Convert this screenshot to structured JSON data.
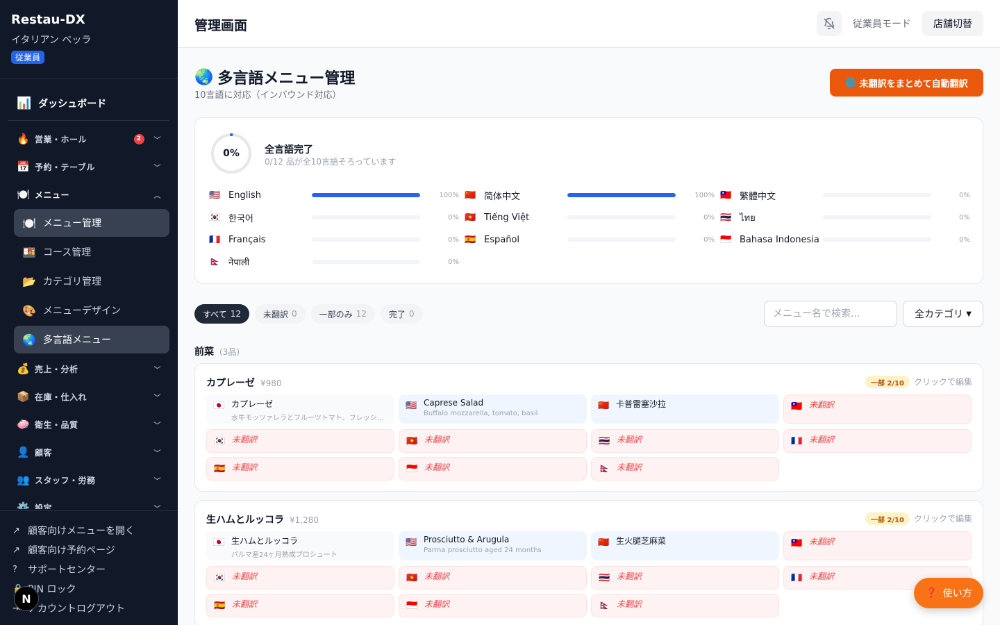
{
  "sidebar": {
    "brand": "Restau-DX",
    "store": "イタリアン ベッラ",
    "role": "従業員",
    "dashboard": "ダッシュボード",
    "groups": [
      {
        "label": "営業・ホール",
        "icon": "🔥",
        "count": "2"
      },
      {
        "label": "予約・テーブル",
        "icon": "📅"
      },
      {
        "label": "メニュー",
        "icon": "🍽️"
      },
      {
        "label": "売上・分析",
        "icon": "💰"
      },
      {
        "label": "在庫・仕入れ",
        "icon": "📦"
      },
      {
        "label": "衛生・品質",
        "icon": "🧼"
      },
      {
        "label": "顧客",
        "icon": "👤"
      },
      {
        "label": "スタッフ・労務",
        "icon": "👥"
      },
      {
        "label": "設定",
        "icon": "⚙️"
      }
    ],
    "menu_items": [
      {
        "label": "メニュー管理",
        "icon": "🍽️"
      },
      {
        "label": "コース管理",
        "icon": "🍱"
      },
      {
        "label": "カテゴリ管理",
        "icon": "📂"
      },
      {
        "label": "メニューデザイン",
        "icon": "🎨"
      },
      {
        "label": "多言語メニュー",
        "icon": "🌏"
      }
    ],
    "bottom_links": [
      "顧客向けメニューを開く",
      "顧客向け予約ページ",
      "サポートセンター",
      "PIN ロック",
      "アカウントログアウト"
    ]
  },
  "header": {
    "title": "管理画面",
    "staff_mode": "従業員モード",
    "store_switch": "店舗切替"
  },
  "main": {
    "heading": "多言語メニュー管理",
    "subheading": "10言語に対応（インバウンド対応）",
    "auto_translate": "未翻訳をまとめて自動翻訳"
  },
  "progress": {
    "overall_pct": "0%",
    "overall": 0,
    "title": "全言語完了",
    "subtitle": "0/12 品が全10言語そろっています",
    "languages": [
      {
        "flag": "🇺🇸",
        "name": "English",
        "pct": "100%",
        "value": 100
      },
      {
        "flag": "🇨🇳",
        "name": "简体中文",
        "pct": "100%",
        "value": 100
      },
      {
        "flag": "🇹🇼",
        "name": "繁體中文",
        "pct": "0%",
        "value": 0
      },
      {
        "flag": "🇰🇷",
        "name": "한국어",
        "pct": "0%",
        "value": 0
      },
      {
        "flag": "🇻🇳",
        "name": "Tiếng Việt",
        "pct": "0%",
        "value": 0
      },
      {
        "flag": "🇹🇭",
        "name": "ไทย",
        "pct": "0%",
        "value": 0
      },
      {
        "flag": "🇫🇷",
        "name": "Français",
        "pct": "0%",
        "value": 0
      },
      {
        "flag": "🇪🇸",
        "name": "Español",
        "pct": "0%",
        "value": 0
      },
      {
        "flag": "🇮🇩",
        "name": "Bahasa Indonesia",
        "pct": "0%",
        "value": 0
      },
      {
        "flag": "🇳🇵",
        "name": "नेपाली",
        "pct": "0%",
        "value": 0
      }
    ]
  },
  "filters": {
    "chips": [
      {
        "label": "すべて",
        "count": "12"
      },
      {
        "label": "未翻訳",
        "count": "0"
      },
      {
        "label": "一部のみ",
        "count": "12"
      },
      {
        "label": "完了",
        "count": "0"
      }
    ],
    "search_placeholder": "メニュー名で検索...",
    "category": "全カテゴリ"
  },
  "section": {
    "name": "前菜",
    "count": "(3品)"
  },
  "items": [
    {
      "name": "カプレーゼ",
      "price": "¥980",
      "badge": "一部 2/10",
      "edit_hint": "クリックで編集",
      "cells": [
        {
          "flag": "🇯🇵",
          "text": "カプレーゼ",
          "desc": "水牛モッツァレラとフルーツトマト、フレッシュバジル",
          "state": "src"
        },
        {
          "flag": "🇺🇸",
          "text": "Caprese Salad",
          "desc": "Buffalo mozzarella, tomato, basil",
          "state": "done"
        },
        {
          "flag": "🇨🇳",
          "text": "卡普雷塞沙拉",
          "desc": "",
          "state": "done"
        },
        {
          "flag": "🇹🇼",
          "text": "未翻訳",
          "state": "miss"
        },
        {
          "flag": "🇰🇷",
          "text": "未翻訳",
          "state": "miss"
        },
        {
          "flag": "🇻🇳",
          "text": "未翻訳",
          "state": "miss"
        },
        {
          "flag": "🇹🇭",
          "text": "未翻訳",
          "state": "miss"
        },
        {
          "flag": "🇫🇷",
          "text": "未翻訳",
          "state": "miss"
        },
        {
          "flag": "🇪🇸",
          "text": "未翻訳",
          "state": "miss"
        },
        {
          "flag": "🇮🇩",
          "text": "未翻訳",
          "state": "miss"
        },
        {
          "flag": "🇳🇵",
          "text": "未翻訳",
          "state": "miss"
        }
      ]
    },
    {
      "name": "生ハムとルッコラ",
      "price": "¥1,280",
      "badge": "一部 2/10",
      "edit_hint": "クリックで編集",
      "cells": [
        {
          "flag": "🇯🇵",
          "text": "生ハムとルッコラ",
          "desc": "パルマ産24ヶ月熟成プロシュート",
          "state": "src"
        },
        {
          "flag": "🇺🇸",
          "text": "Prosciutto & Arugula",
          "desc": "Parma prosciutto aged 24 months",
          "state": "done"
        },
        {
          "flag": "🇨🇳",
          "text": "生火腿芝麻菜",
          "desc": "",
          "state": "done"
        },
        {
          "flag": "🇹🇼",
          "text": "未翻訳",
          "state": "miss"
        },
        {
          "flag": "🇰🇷",
          "text": "未翻訳",
          "state": "miss"
        },
        {
          "flag": "🇻🇳",
          "text": "未翻訳",
          "state": "miss"
        },
        {
          "flag": "🇹🇭",
          "text": "未翻訳",
          "state": "miss"
        },
        {
          "flag": "🇫🇷",
          "text": "未翻訳",
          "state": "miss"
        },
        {
          "flag": "🇪🇸",
          "text": "未翻訳",
          "state": "miss"
        },
        {
          "flag": "🇮🇩",
          "text": "未翻訳",
          "state": "miss"
        },
        {
          "flag": "🇳🇵",
          "text": "未翻訳",
          "state": "miss"
        }
      ]
    }
  ],
  "help_button": "使い方",
  "colors": {
    "accent": "#2563eb",
    "cta": "#ea580c",
    "sidebar": "#111827",
    "missing": "#ef4444"
  }
}
